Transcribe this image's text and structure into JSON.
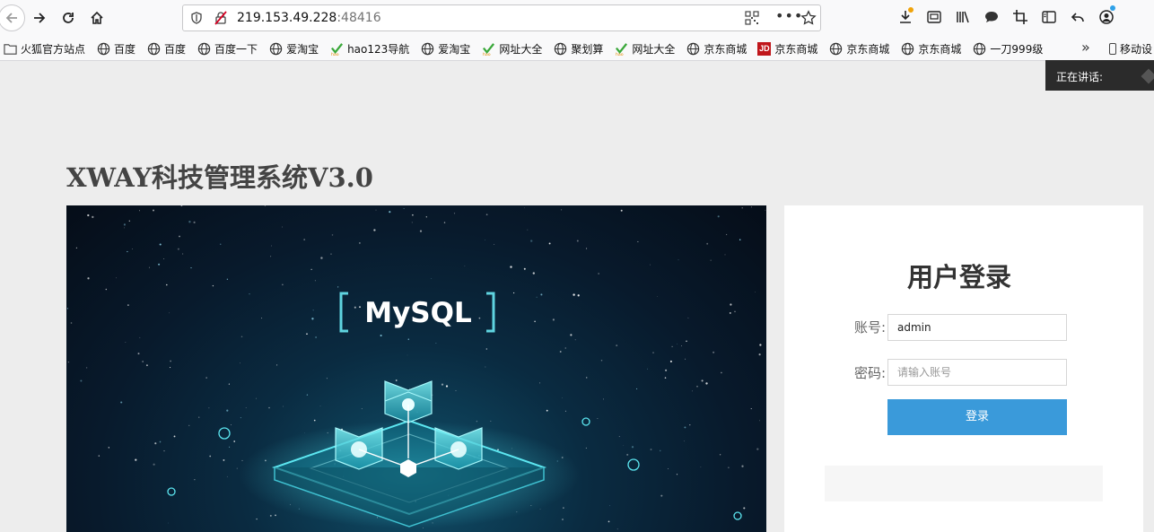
{
  "browser": {
    "url_host": "219.153.49.228",
    "url_port": ":48416",
    "more_label": "•••"
  },
  "bookmarks": [
    {
      "label": "火狐官方站点",
      "icon": "folder-icon"
    },
    {
      "label": "百度",
      "icon": "globe-icon"
    },
    {
      "label": "百度",
      "icon": "globe-icon"
    },
    {
      "label": "百度一下",
      "icon": "globe-icon"
    },
    {
      "label": "爱淘宝",
      "icon": "globe-icon"
    },
    {
      "label": "hao123导航",
      "icon": "hao-icon"
    },
    {
      "label": "爱淘宝",
      "icon": "globe-icon"
    },
    {
      "label": "网址大全",
      "icon": "hao-icon"
    },
    {
      "label": "聚划算",
      "icon": "globe-icon"
    },
    {
      "label": "网址大全",
      "icon": "hao-icon"
    },
    {
      "label": "京东商城",
      "icon": "globe-icon"
    },
    {
      "label": "京东商城",
      "icon": "jd-icon"
    },
    {
      "label": "京东商城",
      "icon": "globe-icon"
    },
    {
      "label": "京东商城",
      "icon": "globe-icon"
    },
    {
      "label": "一刀999级",
      "icon": "globe-icon"
    }
  ],
  "bookmarks_overflow": "»",
  "mobile_bookmarks": "移动设",
  "jd_logo_text": "JD",
  "speaking_label": "正在讲话:",
  "page": {
    "site_title": "XWAY科技管理系统V3.0",
    "hero_text": "MySQL"
  },
  "login": {
    "title": "用户登录",
    "account_label": "账号:",
    "account_value": "admin",
    "password_label": "密码:",
    "password_placeholder": "请输入账号",
    "submit_label": "登录"
  },
  "colors": {
    "accent": "#3a9ada",
    "page_bg": "#ededed",
    "hero_cyan": "#5ce6f0"
  }
}
